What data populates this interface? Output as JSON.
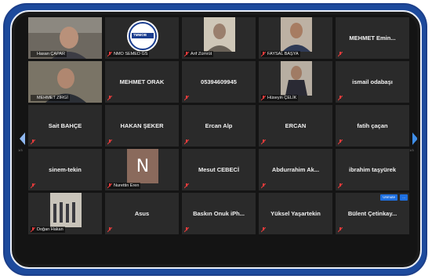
{
  "gallery": {
    "row1": [
      {
        "type": "video",
        "label": "Hasan ÇAPAR"
      },
      {
        "type": "logo",
        "label": "NMO SEMED GS",
        "logo_text": "TMMOB"
      },
      {
        "type": "video",
        "label": "Arif Zümrüt"
      },
      {
        "type": "video",
        "label": "FAYSAL BAŞYA"
      },
      {
        "type": "name",
        "name": "MEHMET  Emin..."
      }
    ],
    "row2": [
      {
        "type": "video",
        "label": "MEHMET ZİRGİ",
        "active": true
      },
      {
        "type": "name",
        "name": "MEHMET ORAK"
      },
      {
        "type": "name",
        "name": "05394609945"
      },
      {
        "type": "video",
        "label": "Hüseyin ÇELİK"
      },
      {
        "type": "name",
        "name": "ismail odabaşı"
      }
    ],
    "row3": [
      {
        "type": "name",
        "name": "Sait BAHÇE"
      },
      {
        "type": "name",
        "name": "HAKAN ŞEKER"
      },
      {
        "type": "name",
        "name": "Ercan Alp"
      },
      {
        "type": "name",
        "name": "ERCAN"
      },
      {
        "type": "name",
        "name": "fatih çaçan"
      }
    ],
    "row4": [
      {
        "type": "name",
        "name": "sinem-tekin"
      },
      {
        "type": "avatar",
        "initial": "N",
        "label": "Nurettin Eren"
      },
      {
        "type": "name",
        "name": "Mesut CEBECİ"
      },
      {
        "type": "name",
        "name": "Abdurrahim  Ak..."
      },
      {
        "type": "name",
        "name": "ibrahim taşyürek"
      }
    ],
    "row5": [
      {
        "type": "video",
        "label": "Doğan Hakan"
      },
      {
        "type": "name",
        "name": "Asus"
      },
      {
        "type": "name",
        "name": "Baskın Onuk iPh..."
      },
      {
        "type": "name",
        "name": "Yüksel Yaşartekin"
      },
      {
        "type": "name",
        "name": "Bülent  Çetinkay..."
      }
    ]
  },
  "pager": {
    "left": "1/3",
    "right": "1/3"
  },
  "overlay_buttons": {
    "primary": "Unmute",
    "secondary": "..."
  },
  "colors": {
    "frame": "#1d4a9c",
    "active_border": "#b8d93a",
    "mute": "#e23b3b",
    "accent": "#1e6fe0"
  }
}
